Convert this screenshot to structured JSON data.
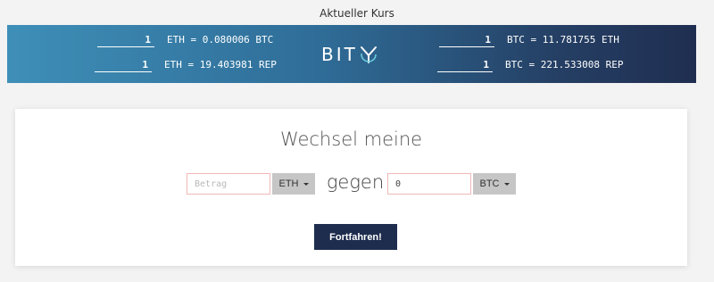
{
  "header": {
    "title": "Aktueller Kurs"
  },
  "logo": {
    "text": "BIT"
  },
  "rates": [
    {
      "amount": "1",
      "text": "ETH = 0.080006 BTC"
    },
    {
      "amount": "1",
      "text": "ETH = 19.403981 REP"
    },
    {
      "amount": "1",
      "text": "BTC = 11.781755 ETH"
    },
    {
      "amount": "1",
      "text": "BTC = 221.533008 REP"
    }
  ],
  "exchange": {
    "title": "Wechsel meine",
    "from_placeholder": "Betrag",
    "from_currency": "ETH",
    "connector": "gegen",
    "to_value": "0",
    "to_currency": "BTC",
    "submit_label": "Fortfahren!"
  },
  "colors": {
    "banner_start": "#3e8fb8",
    "banner_end": "#1f2e50",
    "button": "#1e2d4e",
    "input_border": "#f0b8b8"
  }
}
